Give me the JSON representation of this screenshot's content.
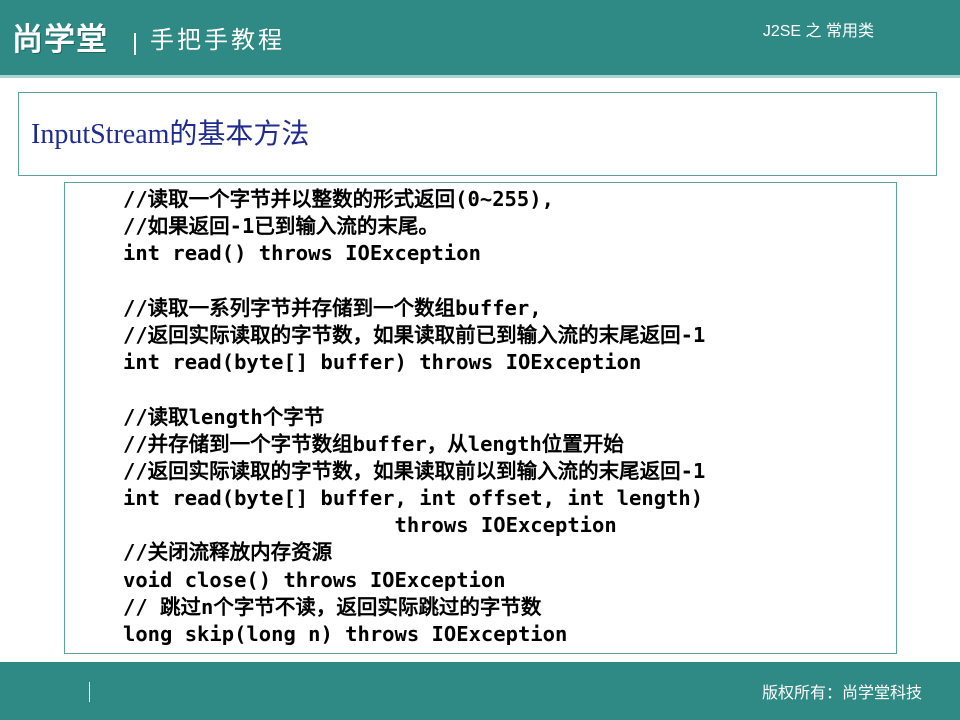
{
  "header": {
    "logo_text": "尚学堂",
    "tagline": "手把手教程",
    "section_label": "J2SE 之 常用类",
    "background_color": "#2f8a85"
  },
  "slide": {
    "title": "InputStream的基本方法",
    "title_color": "#1f2b8f"
  },
  "code_lines": [
    "//读取一个字节并以整数的形式返回(0~255),",
    "//如果返回-1已到输入流的末尾。",
    "int read() throws IOException",
    "",
    "//读取一系列字节并存储到一个数组buffer,",
    "//返回实际读取的字节数，如果读取前已到输入流的末尾返回-1",
    "int read(byte[] buffer) throws IOException",
    "",
    "//读取length个字节",
    "//并存储到一个字节数组buffer，从length位置开始",
    "//返回实际读取的字节数，如果读取前以到输入流的末尾返回-1",
    "int read(byte[] buffer, int offset, int length)",
    "                      throws IOException",
    "//关闭流释放内存资源",
    "void close() throws IOException",
    "// 跳过n个字节不读，返回实际跳过的字节数",
    "long skip(long n) throws IOException"
  ],
  "footer": {
    "copyright": "版权所有：尚学堂科技"
  }
}
